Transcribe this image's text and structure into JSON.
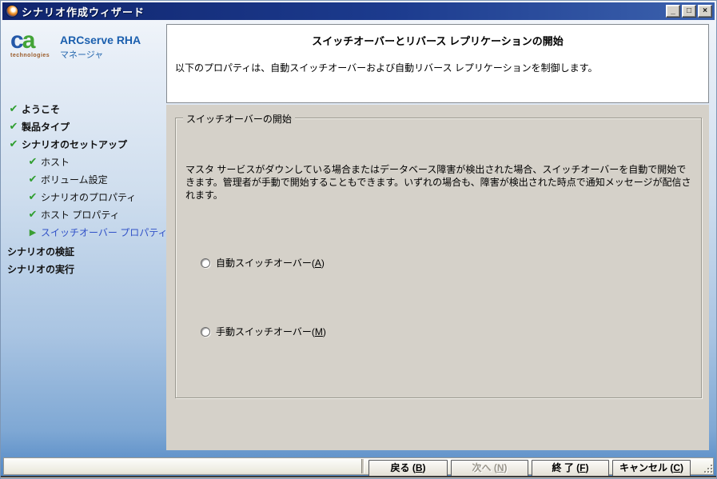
{
  "window": {
    "title": "シナリオ作成ウィザード",
    "controls": {
      "minimize": "_",
      "maximize": "□",
      "close": "×"
    }
  },
  "branding": {
    "logo_c": "c",
    "logo_a": "a",
    "logo_sub": "technologies",
    "product": "ARCserve RHA",
    "product_sub": "マネージャ"
  },
  "icons": {
    "done": "✔",
    "current": "▶"
  },
  "sidebar": {
    "steps": [
      {
        "label": "ようこそ",
        "state": "done",
        "level": 0
      },
      {
        "label": "製品タイプ",
        "state": "done",
        "level": 0
      },
      {
        "label": "シナリオのセットアップ",
        "state": "done",
        "level": 0
      },
      {
        "label": "ホスト",
        "state": "done",
        "level": 1
      },
      {
        "label": "ボリューム設定",
        "state": "done",
        "level": 1
      },
      {
        "label": "シナリオのプロパティ",
        "state": "done",
        "level": 1
      },
      {
        "label": "ホスト プロパティ",
        "state": "done",
        "level": 1
      },
      {
        "label": "スイッチオーバー プロパティ",
        "state": "current",
        "level": 1
      },
      {
        "label": "シナリオの検証",
        "state": "pending",
        "level": 0
      },
      {
        "label": "シナリオの実行",
        "state": "pending",
        "level": 0
      }
    ]
  },
  "header": {
    "title": "スイッチオーバーとリバース レプリケーションの開始",
    "description": "以下のプロパティは、自動スイッチオーバーおよび自動リバース レプリケーションを制御します。"
  },
  "content": {
    "group_title": "スイッチオーバーの開始",
    "description": "マスタ サービスがダウンしている場合またはデータベース障害が検出された場合、スイッチオーバーを自動で開始できます。管理者が手動で開始することもできます。いずれの場合も、障害が検出された時点で通知メッセージが配信されます。",
    "radios": [
      {
        "pre": "自動スイッチオーバー(",
        "key": "A",
        "post": ")",
        "checked": false
      },
      {
        "pre": "手動スイッチオーバー(",
        "key": "M",
        "post": ")",
        "checked": false
      }
    ]
  },
  "footer": {
    "buttons": [
      {
        "pre": "戻る (",
        "key": "B",
        "post": ")",
        "enabled": true
      },
      {
        "pre": "次へ (",
        "key": "N",
        "post": ")",
        "enabled": false
      },
      {
        "pre": "終 了 (",
        "key": "F",
        "post": ")",
        "enabled": true
      },
      {
        "pre": "キャンセル (",
        "key": "C",
        "post": ")",
        "enabled": true
      }
    ]
  },
  "colors": {
    "titlebar_start": "#10256e",
    "titlebar_end": "#3c62ae",
    "content_gray": "#d5d1c9",
    "check_green": "#2f9e2f",
    "current_blue": "#3152c8",
    "brand_blue": "#1b5fae"
  }
}
